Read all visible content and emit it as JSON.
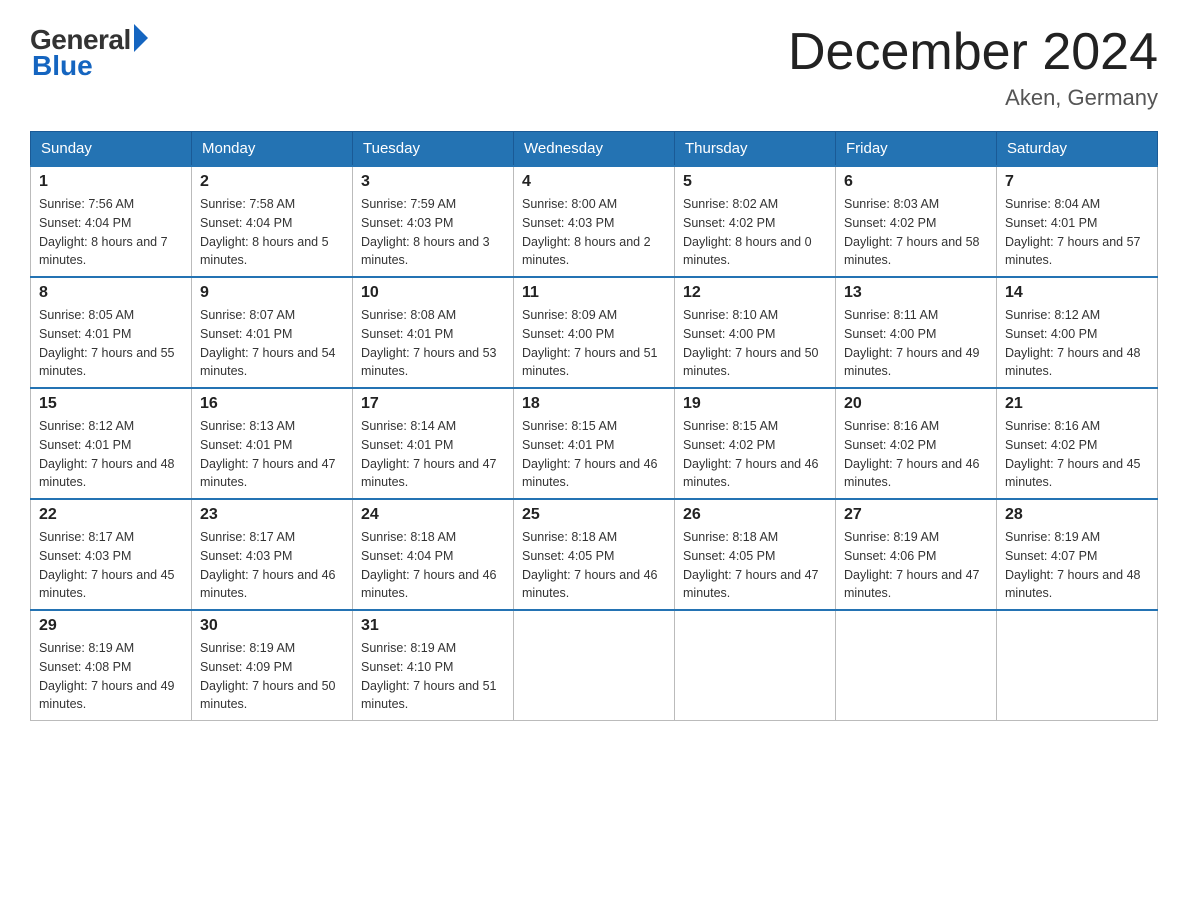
{
  "header": {
    "logo_general": "General",
    "logo_blue": "Blue",
    "month_title": "December 2024",
    "location": "Aken, Germany"
  },
  "weekdays": [
    "Sunday",
    "Monday",
    "Tuesday",
    "Wednesday",
    "Thursday",
    "Friday",
    "Saturday"
  ],
  "weeks": [
    [
      {
        "day": "1",
        "sunrise": "7:56 AM",
        "sunset": "4:04 PM",
        "daylight": "8 hours and 7 minutes."
      },
      {
        "day": "2",
        "sunrise": "7:58 AM",
        "sunset": "4:04 PM",
        "daylight": "8 hours and 5 minutes."
      },
      {
        "day": "3",
        "sunrise": "7:59 AM",
        "sunset": "4:03 PM",
        "daylight": "8 hours and 3 minutes."
      },
      {
        "day": "4",
        "sunrise": "8:00 AM",
        "sunset": "4:03 PM",
        "daylight": "8 hours and 2 minutes."
      },
      {
        "day": "5",
        "sunrise": "8:02 AM",
        "sunset": "4:02 PM",
        "daylight": "8 hours and 0 minutes."
      },
      {
        "day": "6",
        "sunrise": "8:03 AM",
        "sunset": "4:02 PM",
        "daylight": "7 hours and 58 minutes."
      },
      {
        "day": "7",
        "sunrise": "8:04 AM",
        "sunset": "4:01 PM",
        "daylight": "7 hours and 57 minutes."
      }
    ],
    [
      {
        "day": "8",
        "sunrise": "8:05 AM",
        "sunset": "4:01 PM",
        "daylight": "7 hours and 55 minutes."
      },
      {
        "day": "9",
        "sunrise": "8:07 AM",
        "sunset": "4:01 PM",
        "daylight": "7 hours and 54 minutes."
      },
      {
        "day": "10",
        "sunrise": "8:08 AM",
        "sunset": "4:01 PM",
        "daylight": "7 hours and 53 minutes."
      },
      {
        "day": "11",
        "sunrise": "8:09 AM",
        "sunset": "4:00 PM",
        "daylight": "7 hours and 51 minutes."
      },
      {
        "day": "12",
        "sunrise": "8:10 AM",
        "sunset": "4:00 PM",
        "daylight": "7 hours and 50 minutes."
      },
      {
        "day": "13",
        "sunrise": "8:11 AM",
        "sunset": "4:00 PM",
        "daylight": "7 hours and 49 minutes."
      },
      {
        "day": "14",
        "sunrise": "8:12 AM",
        "sunset": "4:00 PM",
        "daylight": "7 hours and 48 minutes."
      }
    ],
    [
      {
        "day": "15",
        "sunrise": "8:12 AM",
        "sunset": "4:01 PM",
        "daylight": "7 hours and 48 minutes."
      },
      {
        "day": "16",
        "sunrise": "8:13 AM",
        "sunset": "4:01 PM",
        "daylight": "7 hours and 47 minutes."
      },
      {
        "day": "17",
        "sunrise": "8:14 AM",
        "sunset": "4:01 PM",
        "daylight": "7 hours and 47 minutes."
      },
      {
        "day": "18",
        "sunrise": "8:15 AM",
        "sunset": "4:01 PM",
        "daylight": "7 hours and 46 minutes."
      },
      {
        "day": "19",
        "sunrise": "8:15 AM",
        "sunset": "4:02 PM",
        "daylight": "7 hours and 46 minutes."
      },
      {
        "day": "20",
        "sunrise": "8:16 AM",
        "sunset": "4:02 PM",
        "daylight": "7 hours and 46 minutes."
      },
      {
        "day": "21",
        "sunrise": "8:16 AM",
        "sunset": "4:02 PM",
        "daylight": "7 hours and 45 minutes."
      }
    ],
    [
      {
        "day": "22",
        "sunrise": "8:17 AM",
        "sunset": "4:03 PM",
        "daylight": "7 hours and 45 minutes."
      },
      {
        "day": "23",
        "sunrise": "8:17 AM",
        "sunset": "4:03 PM",
        "daylight": "7 hours and 46 minutes."
      },
      {
        "day": "24",
        "sunrise": "8:18 AM",
        "sunset": "4:04 PM",
        "daylight": "7 hours and 46 minutes."
      },
      {
        "day": "25",
        "sunrise": "8:18 AM",
        "sunset": "4:05 PM",
        "daylight": "7 hours and 46 minutes."
      },
      {
        "day": "26",
        "sunrise": "8:18 AM",
        "sunset": "4:05 PM",
        "daylight": "7 hours and 47 minutes."
      },
      {
        "day": "27",
        "sunrise": "8:19 AM",
        "sunset": "4:06 PM",
        "daylight": "7 hours and 47 minutes."
      },
      {
        "day": "28",
        "sunrise": "8:19 AM",
        "sunset": "4:07 PM",
        "daylight": "7 hours and 48 minutes."
      }
    ],
    [
      {
        "day": "29",
        "sunrise": "8:19 AM",
        "sunset": "4:08 PM",
        "daylight": "7 hours and 49 minutes."
      },
      {
        "day": "30",
        "sunrise": "8:19 AM",
        "sunset": "4:09 PM",
        "daylight": "7 hours and 50 minutes."
      },
      {
        "day": "31",
        "sunrise": "8:19 AM",
        "sunset": "4:10 PM",
        "daylight": "7 hours and 51 minutes."
      },
      null,
      null,
      null,
      null
    ]
  ],
  "labels": {
    "sunrise_prefix": "Sunrise: ",
    "sunset_prefix": "Sunset: ",
    "daylight_prefix": "Daylight: "
  }
}
